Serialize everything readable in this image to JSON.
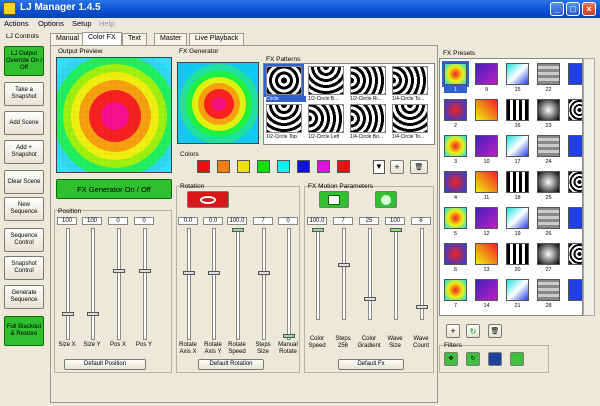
{
  "window": {
    "title": "LJ Manager 1.4.5"
  },
  "menu": [
    "Actions",
    "Options",
    "Setup",
    "Help"
  ],
  "left_title": "LJ Controls",
  "left_buttons": [
    "LJ Output Override On / Off",
    "Take a Snapshot",
    "Add Scene",
    "Add + Snapshot",
    "Clear Scene",
    "New Sequence",
    "Sequence Control",
    "Snapshot Control",
    "Generate Sequence",
    "Full Blackout & Restore"
  ],
  "tabs": [
    "Manual",
    "Color FX",
    "Text",
    "Master",
    "Live Playback"
  ],
  "output_preview": {
    "title": "Output Preview"
  },
  "fx_generator": {
    "title": "FX Generator",
    "button": "FX Generator On / Off"
  },
  "fx_patterns": {
    "title": "FX Patterns",
    "items": [
      "Circle",
      "1/2-Circle B...",
      "1/2-Circle Ri...",
      "1/4-Circle To...",
      "1/2-Circle Top",
      "1/2-Circle Left",
      "1/4-Circle Bo...",
      "1/4-Circle To..."
    ]
  },
  "colors": {
    "title": "Colors",
    "swatches": [
      "#e81010",
      "#f08010",
      "#f0e010",
      "#10e010",
      "#10f0f0",
      "#1010e0",
      "#e010e0",
      "#e81010"
    ]
  },
  "position": {
    "title": "Position",
    "values": [
      "100",
      "100",
      "0",
      "0"
    ],
    "labels": [
      "Size X",
      "Size Y",
      "Pos X",
      "Pos Y"
    ],
    "default": "Default Position",
    "levels": [
      0.22,
      0.22,
      0.62,
      0.62
    ]
  },
  "rotation": {
    "title": "Rotation",
    "values": [
      "0.0",
      "0.0",
      "100.0",
      "7",
      "0"
    ],
    "labels": [
      "Rotate Axis X",
      "Rotate Axis Y",
      "Rotate Speed",
      "Steps Size",
      "Manual Rotate"
    ],
    "default": "Default Rotation",
    "levels": [
      0.6,
      0.6,
      1.0,
      0.6,
      0.02
    ]
  },
  "motion": {
    "title": "FX Motion Parameters",
    "values": [
      "100.0",
      "7",
      "25",
      "100",
      "8"
    ],
    "labels": [
      "Color Speed",
      "Steps 256",
      "Color Gradient",
      "Wave Size",
      "Wave Count"
    ],
    "default": "Default Fx",
    "levels": [
      1.0,
      0.6,
      0.22,
      1.0,
      0.12
    ]
  },
  "presets": {
    "title": "FX Presets",
    "numbers": [
      "1",
      "9",
      "15",
      "22",
      "",
      "2",
      "",
      "16",
      "23",
      "",
      "3",
      "10",
      "17",
      "24",
      "",
      "4",
      "11",
      "18",
      "25",
      "",
      "5",
      "12",
      "19",
      "26",
      "",
      "6",
      "13",
      "20",
      "27",
      "",
      "7",
      "14",
      "21",
      "28",
      ""
    ]
  },
  "filters": {
    "title": "Filters"
  }
}
